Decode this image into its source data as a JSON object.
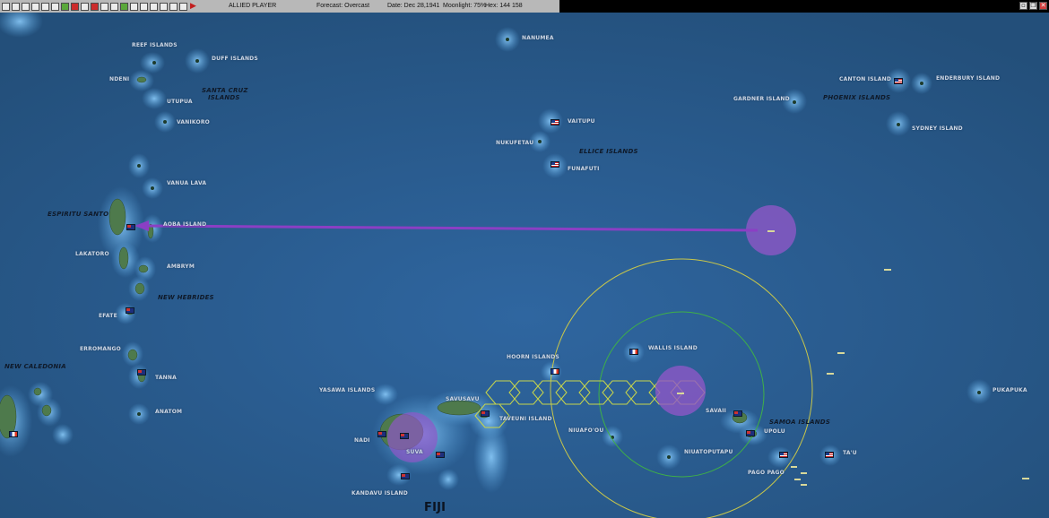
{
  "toolbar": {
    "player_label": "ALLIED PLAYER",
    "forecast": "Forecast: Overcast",
    "date": "Date: Dec 28,1941",
    "moonlight": "Moonlight: 75%",
    "hex": "Hex: 144 158",
    "buttons": [
      "toolbar-button-1",
      "toolbar-button-2",
      "toolbar-button-3",
      "toolbar-button-4",
      "toolbar-button-5",
      "toolbar-button-6",
      "toolbar-button-7",
      "toolbar-button-8",
      "toolbar-button-9",
      "toolbar-button-10",
      "toolbar-button-11",
      "toolbar-button-12",
      "toolbar-button-13",
      "toolbar-button-14",
      "toolbar-button-15",
      "toolbar-button-16",
      "toolbar-button-17",
      "toolbar-button-18",
      "toolbar-button-19"
    ],
    "end_turn_icon": "play-icon"
  },
  "window_controls": {
    "minimize_icon": "minimize-icon",
    "restore_icon": "restore-icon",
    "close_icon": "close-icon"
  },
  "map": {
    "colors": {
      "ocean": "#2a5985",
      "land": "#4e7a4c",
      "island_glow": "#79b8e6",
      "task_force": "#8f57c8",
      "movement_arrow": "#8b3fc4",
      "range_outer": "#c8c64a",
      "range_inner": "#3fb047",
      "hex_path": "#c9d64a"
    },
    "labels": {
      "reef_islands": "REEF ISLANDS",
      "duff_islands": "DUFF ISLANDS",
      "ndeni": "NDENI",
      "santa_cruz": "SANTA CRUZ",
      "santa_cruz_2": "ISLANDS",
      "utupua": "UTUPUA",
      "vanikoro": "VANIKORO",
      "vanua_lava": "VANUA LAVA",
      "espiritu_santo": "ESPIRITU SANTO",
      "aoba_island": "AOBA ISLAND",
      "lakatoro": "LAKATORO",
      "ambrym": "AMBRYM",
      "new_hebrides": "NEW HEBRIDES",
      "efate": "EFATE",
      "erromango": "ERROMANGO",
      "tanna": "TANNA",
      "anatom": "ANATOM",
      "new_caledonia": "NEW CALEDONIA",
      "nanumea": "NANUMEA",
      "vaitupu": "VAITUPU",
      "nukufetau": "NUKUFETAU",
      "ellice_islands": "ELLICE ISLANDS",
      "funafuti": "FUNAFUTI",
      "gardner_island": "GARDNER ISLAND",
      "canton_island": "CANTON ISLAND",
      "enderbury_island": "ENDERBURY ISLAND",
      "phoenix_islands": "PHOENIX ISLANDS",
      "sydney_island": "SYDNEY ISLAND",
      "hoorn_islands": "HOORN ISLANDS",
      "wallis_island": "WALLIS ISLAND",
      "yasawa_islands": "YASAWA ISLANDS",
      "savusavu": "SAVUSAVU",
      "taveuni_island": "TAVEUNI ISLAND",
      "nadi": "NADI",
      "suva": "SUVA",
      "kandavu_island": "KANDAVU ISLAND",
      "fiji": "FIJI",
      "niuafo_ou": "NIUAFO'OU",
      "niuatoputapu": "NIUATOPUTAPU",
      "savaii": "SAVAII",
      "samoa_islands": "SAMOA ISLANDS",
      "upolu": "UPOLU",
      "pago_pago": "PAGO PAGO",
      "ta_u": "TA'U",
      "pukapuka": "PUKAPUKA"
    }
  }
}
